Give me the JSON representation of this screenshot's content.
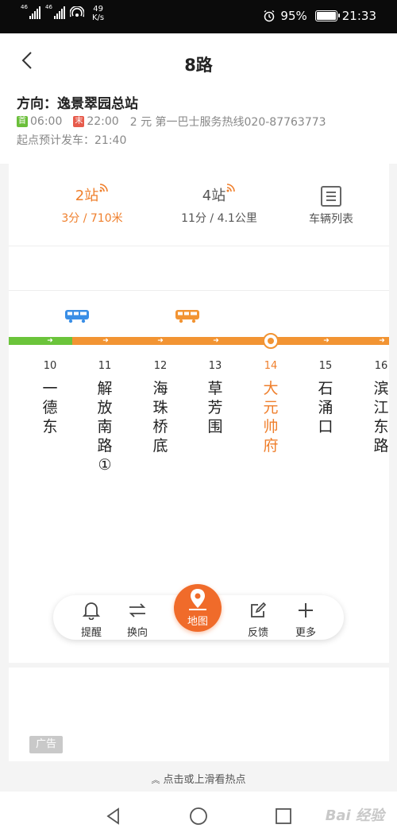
{
  "status_bar": {
    "network_label_1": "46",
    "network_label_2": "46",
    "speed_value": "49",
    "speed_unit": "K/s",
    "battery": "95%",
    "time": "21:33"
  },
  "header": {
    "title": "8路",
    "direction_label": "方向：",
    "direction_value": "逸景翠园总站",
    "first_badge": "首",
    "first_time": "06:00",
    "last_badge": "末",
    "last_time": "22:00",
    "fare_and_hotline": "2 元 第一巴士服务热线020-87763773",
    "departure": "起点预计发车：21:40"
  },
  "summary": {
    "bus1_stops": "2站",
    "bus1_eta": "3分 / 710米",
    "bus2_stops": "4站",
    "bus2_eta": "11分 / 4.1公里",
    "vehicle_list": "车辆列表"
  },
  "stops": [
    {
      "num": "10",
      "name": "一\n德\n东"
    },
    {
      "num": "11",
      "name": "解\n放\n南\n路\n①"
    },
    {
      "num": "12",
      "name": "海\n珠\n桥\n底"
    },
    {
      "num": "13",
      "name": "草\n芳\n围"
    },
    {
      "num": "14",
      "name": "大\n元\n帅\n府"
    },
    {
      "num": "15",
      "name": "石\n涌\n口"
    },
    {
      "num": "16",
      "name": "滨\n江\n东\n路"
    }
  ],
  "toolbar": {
    "remind": "提醒",
    "switch": "换向",
    "map": "地图",
    "feedback": "反馈",
    "more": "更多"
  },
  "ad": {
    "tag": "广告"
  },
  "hint": "点击或上滑看热点",
  "watermark": "Bai 经验",
  "colors": {
    "accent_orange": "#ef7f2c",
    "track_green": "#6bc43b",
    "track_orange": "#f29433",
    "bus_blue": "#3a8ee6",
    "bus_orange": "#f29433",
    "map_button": "#f06b2a"
  },
  "icons": [
    "back-icon",
    "realtime-signal-icon",
    "list-icon",
    "bus-icon",
    "bell-icon",
    "swap-icon",
    "map-pin-icon",
    "edit-icon",
    "plus-icon"
  ]
}
